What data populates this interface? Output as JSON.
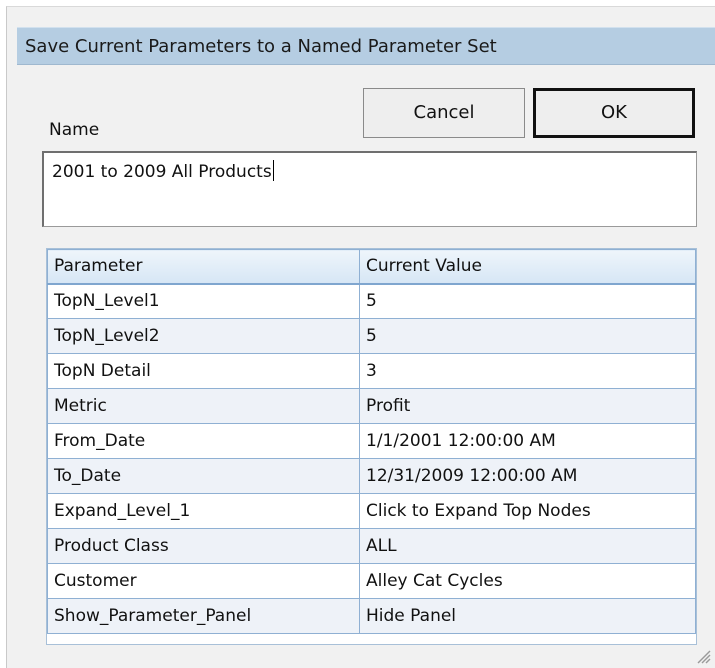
{
  "dialog": {
    "title": "Save Current Parameters to a Named Parameter Set",
    "name_label": "Name",
    "name_value": "2001 to 2009 All Products",
    "cancel_label": "Cancel",
    "ok_label": "OK"
  },
  "grid": {
    "headers": [
      "Parameter",
      "Current Value"
    ],
    "rows": [
      {
        "parameter": "TopN_Level1",
        "value": "5"
      },
      {
        "parameter": "TopN_Level2",
        "value": "5"
      },
      {
        "parameter": "TopN Detail",
        "value": "3"
      },
      {
        "parameter": "Metric",
        "value": "Profit"
      },
      {
        "parameter": "From_Date",
        "value": "1/1/2001 12:00:00 AM"
      },
      {
        "parameter": "To_Date",
        "value": "12/31/2009 12:00:00 AM"
      },
      {
        "parameter": "Expand_Level_1",
        "value": "Click to Expand Top Nodes"
      },
      {
        "parameter": "Product Class",
        "value": "ALL"
      },
      {
        "parameter": "Customer",
        "value": "Alley Cat Cycles"
      },
      {
        "parameter": "Show_Parameter_Panel",
        "value": "Hide Panel"
      }
    ]
  },
  "colors": {
    "titlebar": "#b5cde2",
    "dialog_bg": "#f1f1f1",
    "grid_border": "#8fb0d3",
    "alt_row": "#eef2f8"
  },
  "icons": {
    "resize_grip": "resize-grip-icon"
  }
}
